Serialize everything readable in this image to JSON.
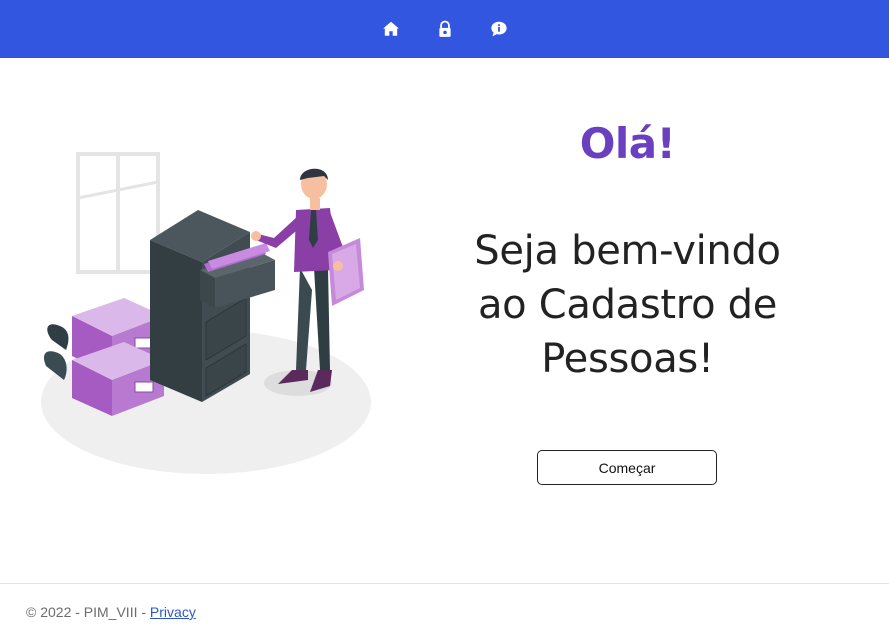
{
  "navbar": {
    "icons": [
      "home-icon",
      "lock-icon",
      "chat-info-icon"
    ],
    "background": "#3356e0"
  },
  "hero": {
    "greeting": "Olá!",
    "welcome_lines": [
      "Seja bem-vindo",
      "ao Cadastro de",
      "Pessoas!"
    ],
    "start_button": "Começar",
    "greeting_color": "#6a3fc0"
  },
  "footer": {
    "copyright": "© 2022 - PIM_VIII - ",
    "privacy_link": "Privacy"
  }
}
